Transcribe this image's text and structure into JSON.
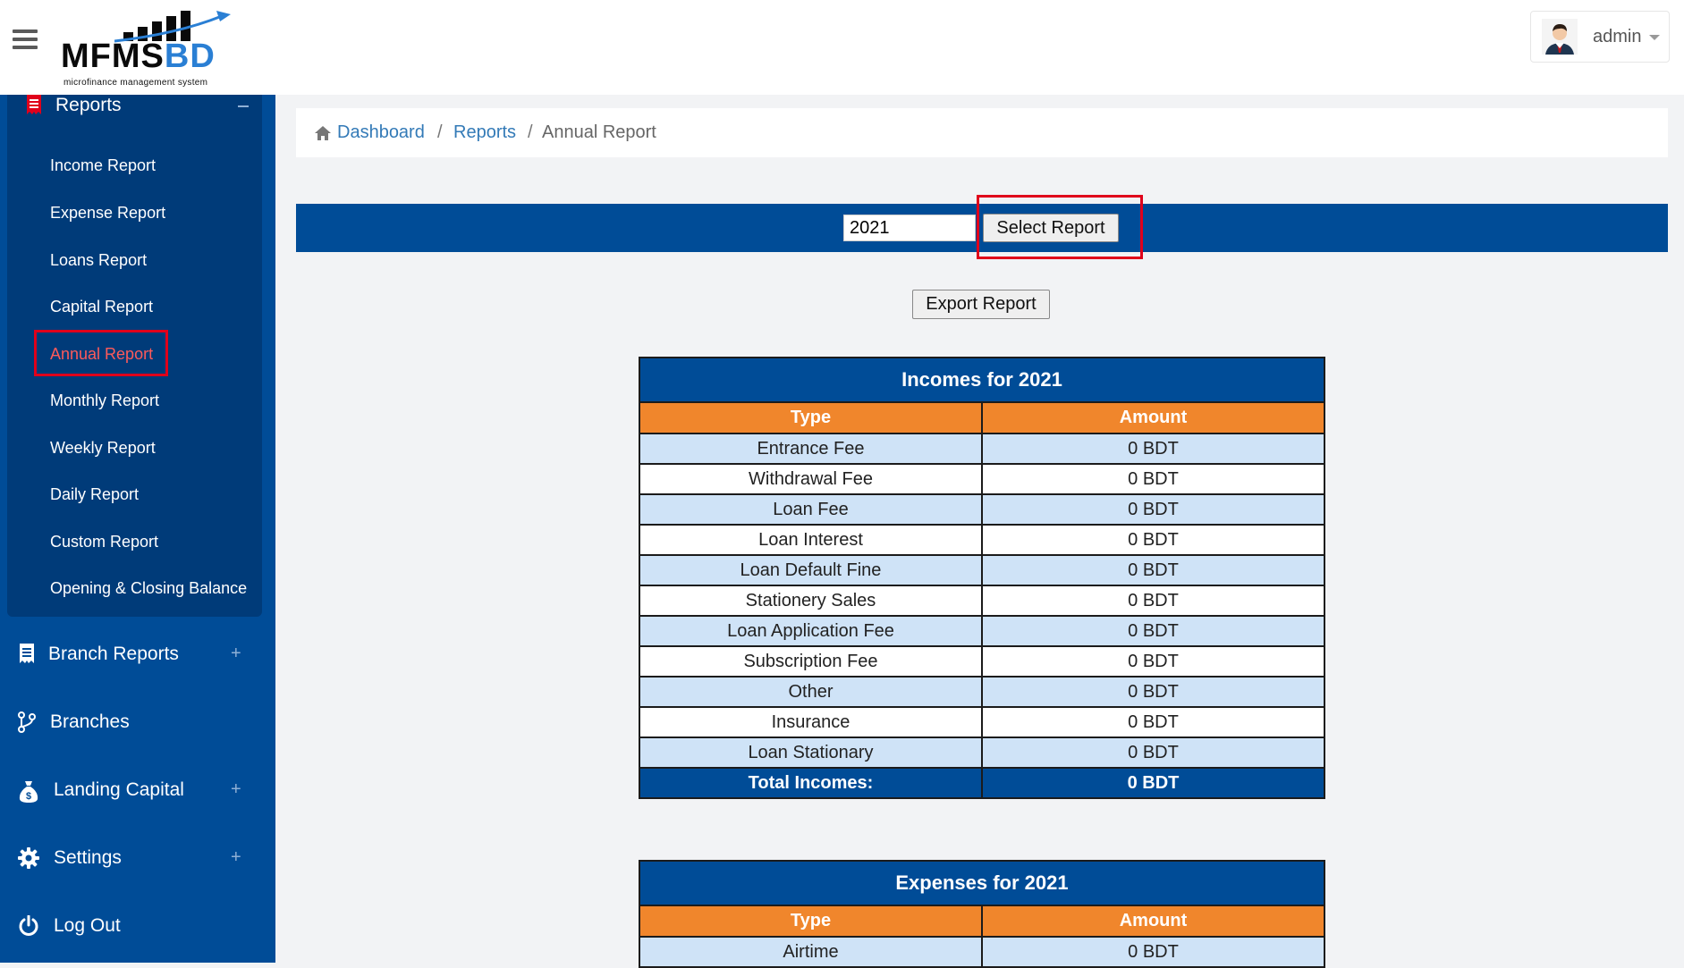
{
  "header": {
    "logo": {
      "text_main": "MFMS",
      "text_accent": "BD",
      "tagline": "microfinance management system"
    },
    "user": {
      "name": "admin",
      "avatar_icon": "user-avatar"
    }
  },
  "sidebar": {
    "group": {
      "label": "Reports",
      "icon": "receipt-icon",
      "toggle": "−"
    },
    "sub_items": [
      {
        "label": "Income Report"
      },
      {
        "label": "Expense Report"
      },
      {
        "label": "Loans Report"
      },
      {
        "label": "Capital Report"
      },
      {
        "label": "Annual Report",
        "active": true
      },
      {
        "label": "Monthly Report"
      },
      {
        "label": "Weekly Report"
      },
      {
        "label": "Daily Report"
      },
      {
        "label": "Custom Report"
      },
      {
        "label": "Opening & Closing Balance"
      }
    ],
    "main_items": [
      {
        "label": "Branch Reports",
        "icon": "receipt-icon",
        "toggle": "+"
      },
      {
        "label": "Branches",
        "icon": "branch-icon",
        "toggle": ""
      },
      {
        "label": "Landing Capital",
        "icon": "money-bag-icon",
        "toggle": "+"
      },
      {
        "label": "Settings",
        "icon": "gear-icon",
        "toggle": "+"
      },
      {
        "label": "Log Out",
        "icon": "power-icon",
        "toggle": ""
      }
    ]
  },
  "breadcrumb": {
    "items": [
      "Dashboard",
      "Reports"
    ],
    "separator": "/",
    "current": "Annual Report"
  },
  "filter": {
    "year_value": "2021",
    "select_label": "Select Report"
  },
  "export_label": "Export Report",
  "incomes": {
    "title": "Incomes for 2021",
    "col_type": "Type",
    "col_amount": "Amount",
    "rows": [
      {
        "type": "Entrance Fee",
        "amount": "0 BDT"
      },
      {
        "type": "Withdrawal Fee",
        "amount": "0 BDT"
      },
      {
        "type": "Loan Fee",
        "amount": "0 BDT"
      },
      {
        "type": "Loan Interest",
        "amount": "0 BDT"
      },
      {
        "type": "Loan Default Fine",
        "amount": "0 BDT"
      },
      {
        "type": "Stationery Sales",
        "amount": "0 BDT"
      },
      {
        "type": "Loan Application Fee",
        "amount": "0 BDT"
      },
      {
        "type": "Subscription Fee",
        "amount": "0 BDT"
      },
      {
        "type": "Other",
        "amount": "0 BDT"
      },
      {
        "type": "Insurance",
        "amount": "0 BDT"
      },
      {
        "type": "Loan Stationary",
        "amount": "0 BDT"
      }
    ],
    "total_label": "Total Incomes:",
    "total_value": "0 BDT"
  },
  "expenses": {
    "title": "Expenses for 2021",
    "col_type": "Type",
    "col_amount": "Amount",
    "rows": [
      {
        "type": "Airtime",
        "amount": "0 BDT"
      }
    ]
  },
  "colors": {
    "brand_blue": "#004c97",
    "sidebar_sub": "#003b79",
    "table_header_orange": "#f0862c",
    "row_highlight": "#cfe3f7",
    "annotation_red": "#e0001b",
    "active_item": "#ff5a5a"
  }
}
